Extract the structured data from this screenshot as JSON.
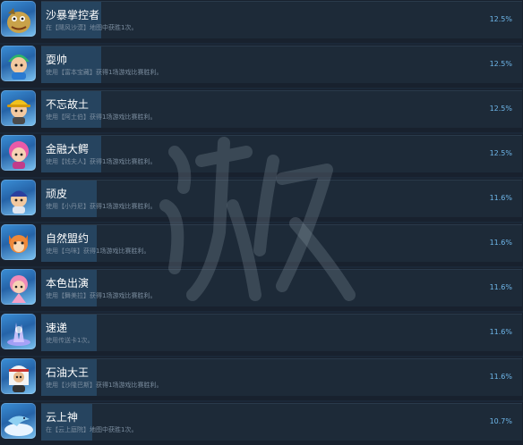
{
  "colors": {
    "page_bg": "#1b2838",
    "row_bg": "#1d2a38",
    "bar_fill": "#26445f",
    "title_text": "#ffffff",
    "desc_text": "#7b8d9f",
    "percent_text": "#6fb7ea"
  },
  "achievements": [
    {
      "title": "沙暴掌控者",
      "desc": "在【飓风沙漠】地图中获胜1次。",
      "percent": "12.5%",
      "rate": 12.5,
      "icon": "sand-monster-character-icon"
    },
    {
      "title": "耍帅",
      "desc": "使用【富本宝藏】获得1场游戏比赛胜利。",
      "percent": "12.5%",
      "rate": 12.5,
      "icon": "green-hair-character-icon"
    },
    {
      "title": "不忘故土",
      "desc": "使用【阿土伯】获得1场游戏比赛胜利。",
      "percent": "12.5%",
      "rate": 12.5,
      "icon": "yellow-hat-character-icon"
    },
    {
      "title": "金融大鳄",
      "desc": "使用【钱夫人】获得1场游戏比赛胜利。",
      "percent": "12.5%",
      "rate": 12.5,
      "icon": "pink-hair-character-icon"
    },
    {
      "title": "顽皮",
      "desc": "使用【小丹尼】获得1场游戏比赛胜利。",
      "percent": "11.6%",
      "rate": 11.6,
      "icon": "blue-cap-boy-icon"
    },
    {
      "title": "自然盟约",
      "desc": "使用【乌咪】获得1场游戏比赛胜利。",
      "percent": "11.6%",
      "rate": 11.6,
      "icon": "orange-fox-character-icon"
    },
    {
      "title": "本色出演",
      "desc": "使用【舞美拉】获得1场游戏比赛胜利。",
      "percent": "11.6%",
      "rate": 11.6,
      "icon": "pink-dancer-character-icon"
    },
    {
      "title": "速递",
      "desc": "使用传送卡1次。",
      "percent": "11.6%",
      "rate": 11.6,
      "icon": "teleport-card-icon"
    },
    {
      "title": "石油大王",
      "desc": "使用【沙隆巴斯】获得1场游戏比赛胜利。",
      "percent": "11.6%",
      "rate": 11.6,
      "icon": "oil-sheik-character-icon"
    },
    {
      "title": "云上神",
      "desc": "在【云上庭院】地图中获胜1次。",
      "percent": "10.7%",
      "rate": 10.7,
      "icon": "cloud-dolphin-icon"
    }
  ]
}
